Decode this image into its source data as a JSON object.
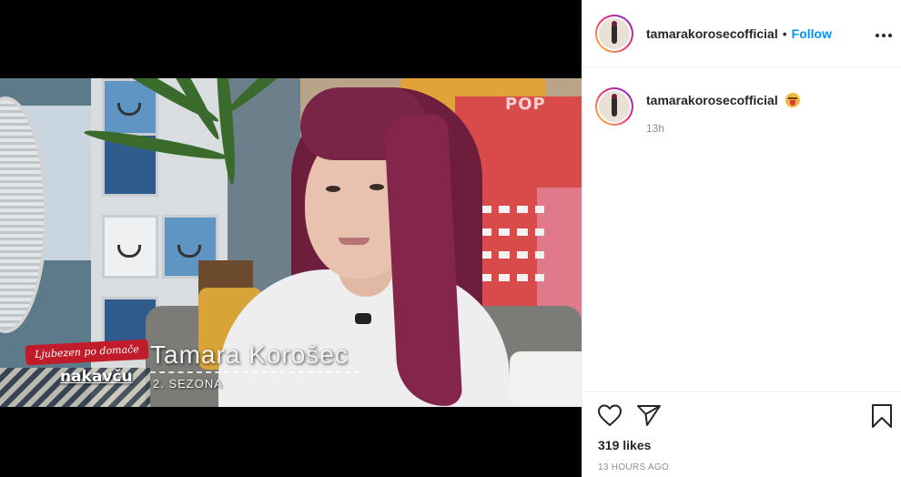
{
  "post": {
    "username": "tamarakorosecofficial",
    "follow_label": "Follow",
    "separator": "•",
    "more_label": "•••",
    "caption": {
      "username": "tamarakorosecofficial",
      "emoji": "squinting-face-with-tongue",
      "time": "13h"
    },
    "likes": "319 likes",
    "posted": "13 HOURS AGO"
  },
  "media": {
    "tv_watermark": "POP",
    "show_banner": "Ljubezen po domače",
    "show_logo": "nakavču",
    "lower_third_name": "Tamara Korošec",
    "lower_third_sub": "2. SEZONA"
  },
  "icons": {
    "like": "heart-icon",
    "share": "send-icon",
    "save": "bookmark-icon",
    "more": "more-options-icon"
  },
  "colors": {
    "follow": "#0095f6",
    "text": "#262626",
    "muted": "#8e8e8e",
    "border": "#efefef",
    "story_ring_start": "#f9ce34",
    "story_ring_mid": "#ee2a7b",
    "story_ring_end": "#6228d7"
  }
}
